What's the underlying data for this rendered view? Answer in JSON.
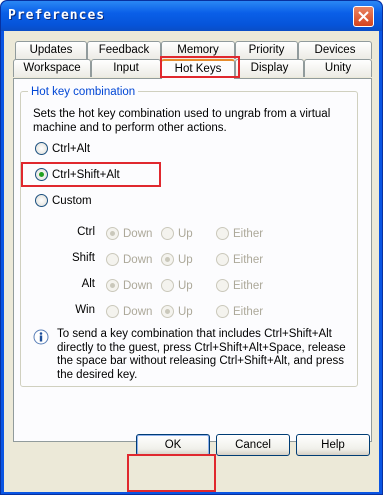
{
  "window": {
    "title": "Preferences"
  },
  "tabs_row1": [
    "Updates",
    "Feedback",
    "Memory",
    "Priority",
    "Devices"
  ],
  "tabs_row2": [
    "Workspace",
    "Input",
    "Hot Keys",
    "Display",
    "Unity"
  ],
  "active_tab": "Hot Keys",
  "group": {
    "title": "Hot key combination",
    "description": "Sets the hot key combination used to ungrab from a virtual machine and to perform other actions."
  },
  "options": {
    "ctrl_alt": "Ctrl+Alt",
    "ctrl_shift_alt": "Ctrl+Shift+Alt",
    "custom": "Custom",
    "selected": "Ctrl+Shift+Alt"
  },
  "custom_keys": [
    {
      "key": "Ctrl",
      "down": "Down",
      "up": "Up",
      "either": "Either",
      "selected": "Down"
    },
    {
      "key": "Shift",
      "down": "Down",
      "up": "Up",
      "either": "Either",
      "selected": "Up"
    },
    {
      "key": "Alt",
      "down": "Down",
      "up": "Up",
      "either": "Either",
      "selected": "Down"
    },
    {
      "key": "Win",
      "down": "Down",
      "up": "Up",
      "either": "Either",
      "selected": "Up"
    }
  ],
  "info": {
    "icon": "info-icon",
    "text": "To send a key combination that includes Ctrl+Shift+Alt directly to the guest, press Ctrl+Shift+Alt+Space, release the space bar without releasing Ctrl+Shift+Alt, and press the desired key."
  },
  "buttons": {
    "ok": "OK",
    "cancel": "Cancel",
    "help": "Help"
  },
  "colors": {
    "highlight": "#e0282e",
    "title_bar": "#0a5fe8",
    "group_title": "#0046d5"
  }
}
